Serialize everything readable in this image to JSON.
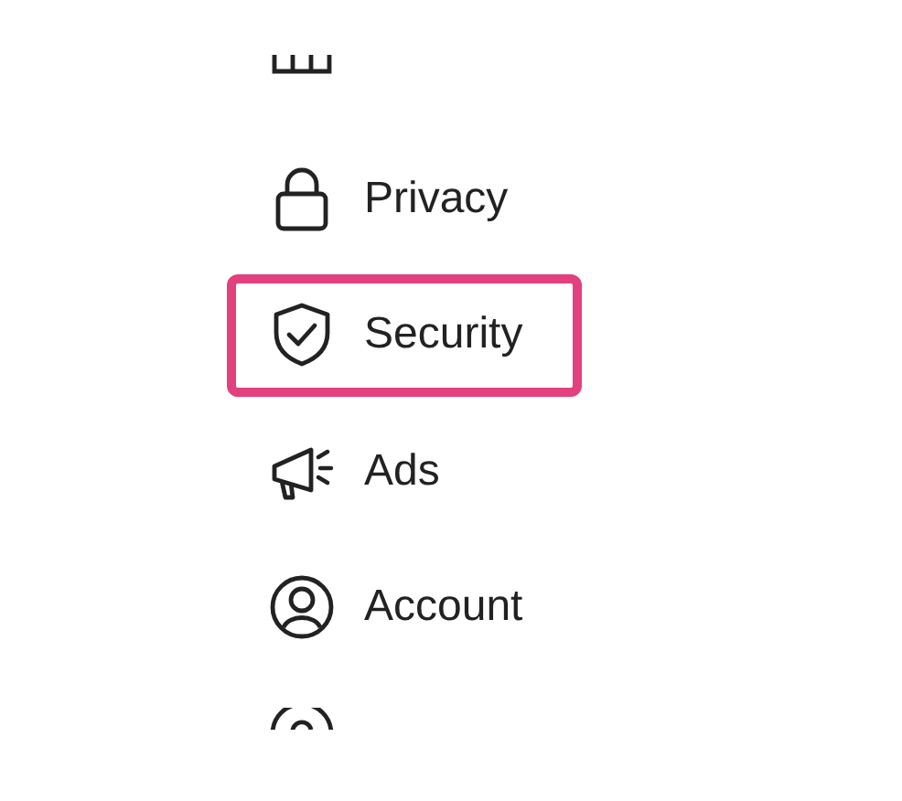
{
  "settings_menu": {
    "items": [
      {
        "kind": "lock",
        "label": "Privacy",
        "selected": false
      },
      {
        "kind": "shield",
        "label": "Security",
        "selected": true
      },
      {
        "kind": "megaphone",
        "label": "Ads",
        "selected": false
      },
      {
        "kind": "account",
        "label": "Account",
        "selected": false
      }
    ]
  }
}
